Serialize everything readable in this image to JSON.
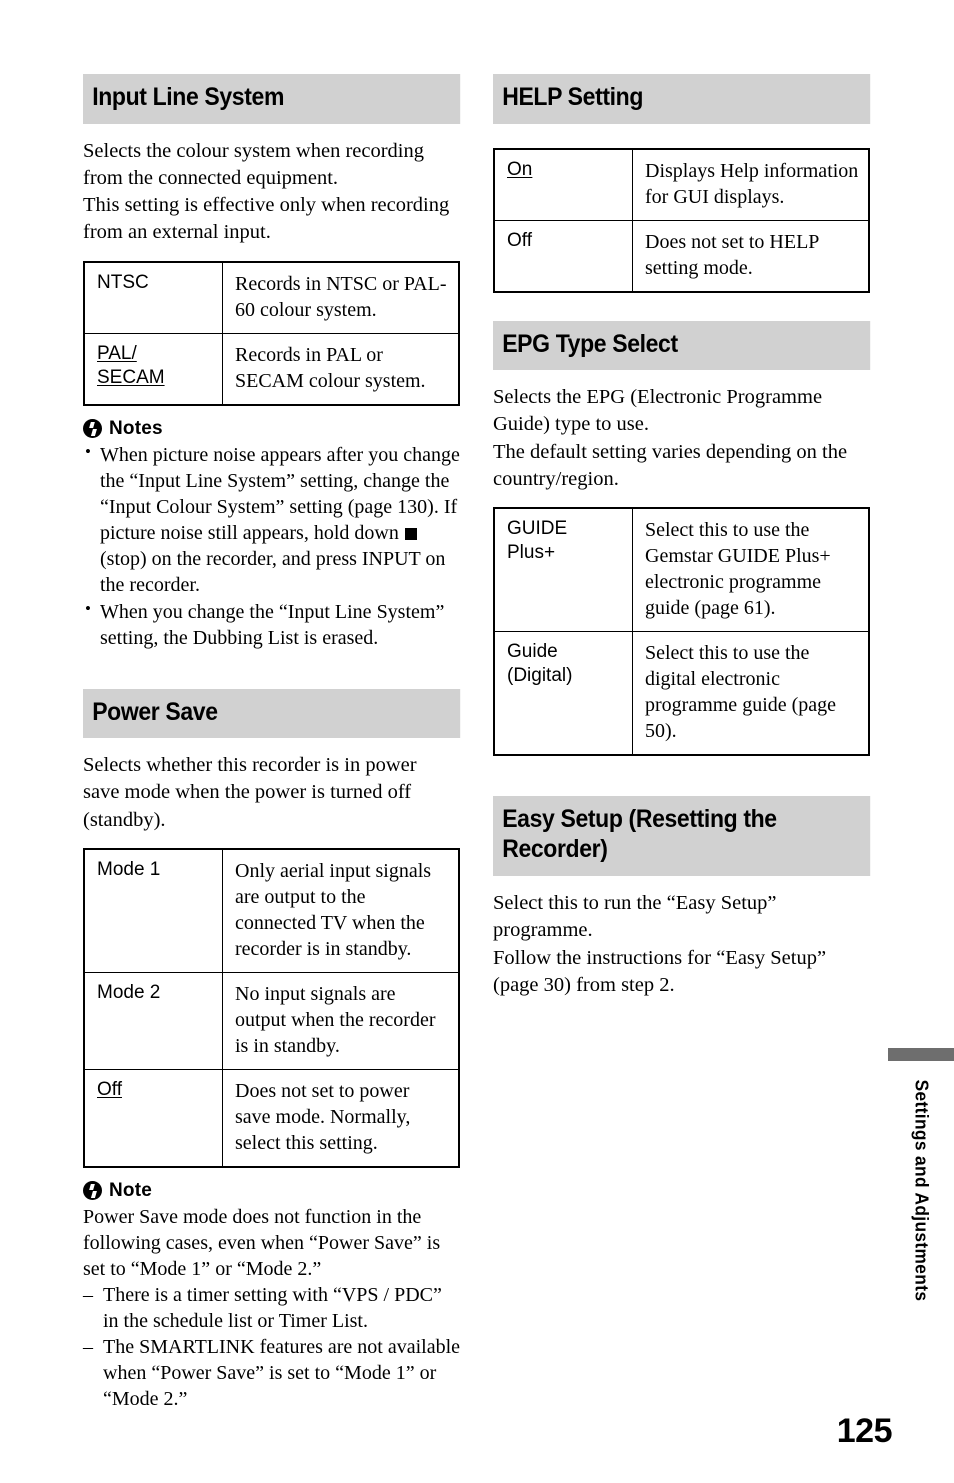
{
  "page": {
    "number": "125",
    "side_tab_label": "Settings and Adjustments"
  },
  "left_column": {
    "input_line_system": {
      "heading": "Input Line System",
      "intro_line_1": "Selects the colour system when recording",
      "intro_line_2": "from the connected equipment.",
      "intro_line_3": "This setting is effective only when recording",
      "intro_line_4": "from an external input.",
      "table": [
        {
          "term": "NTSC",
          "term_underlined": false,
          "description": "Records in NTSC or PAL-60 colour system."
        },
        {
          "term_line_1": "PAL/",
          "term_line_2": "SECAM",
          "term_underlined": true,
          "description": "Records in PAL or SECAM colour system."
        }
      ],
      "notes_title": "Notes",
      "notes_icon": "note-lightning-icon",
      "notes": [
        {
          "text_before_symbol": "When picture noise appears after you change the “Input Line System” setting, change the “Input Colour System” setting (page 130). If picture noise still appears, hold down ",
          "symbol": "stop-square-icon",
          "text_after_symbol": " (stop) on the recorder, and press INPUT on the recorder."
        },
        {
          "text_before_symbol": "When you change the “Input Line System” setting, the Dubbing List is erased.",
          "symbol": null,
          "text_after_symbol": ""
        }
      ]
    },
    "power_save": {
      "heading": "Power Save",
      "intro_line_1": "Selects whether this recorder is in power",
      "intro_line_2": "save mode when the power is turned off",
      "intro_line_3": "(standby).",
      "table": [
        {
          "term": "Mode 1",
          "term_underlined": false,
          "description": "Only aerial input signals are output to the connected TV when the recorder is in standby."
        },
        {
          "term": "Mode 2",
          "term_underlined": false,
          "description": "No input signals are output when the recorder is in standby."
        },
        {
          "term": "Off",
          "term_underlined": true,
          "description": "Does not set to power save mode. Normally, select this setting."
        }
      ],
      "note_title": "Note",
      "note_icon": "note-lightning-icon",
      "note_paragraph": "Power Save mode does not function in the following cases, even when “Power Save” is set to “Mode 1” or “Mode 2.”",
      "note_items": [
        "There is a timer setting with “VPS / PDC” in the schedule list or Timer List.",
        "The SMARTLINK features are not available when “Power Save” is set to “Mode 1” or “Mode 2.”"
      ]
    }
  },
  "right_column": {
    "help_setting": {
      "heading": "HELP Setting",
      "table": [
        {
          "term": "On",
          "term_underlined": true,
          "description": "Displays Help information for GUI displays."
        },
        {
          "term": "Off",
          "term_underlined": false,
          "description": "Does not set to HELP setting mode."
        }
      ]
    },
    "epg_type_select": {
      "heading": "EPG Type Select",
      "intro_line_1": "Selects the EPG (Electronic Programme",
      "intro_line_2": "Guide) type to use.",
      "intro_line_3": "The default setting varies depending on the",
      "intro_line_4": "country/region.",
      "table": [
        {
          "term_line_1": "GUIDE",
          "term_line_2": "Plus+",
          "term_underlined": false,
          "description": "Select this to use the Gemstar GUIDE Plus+ electronic programme guide (page 61)."
        },
        {
          "term_line_1": "Guide",
          "term_line_2": "(Digital)",
          "term_underlined": false,
          "description": "Select this to use the digital electronic programme guide (page 50)."
        }
      ]
    },
    "easy_setup": {
      "heading_line_1": "Easy Setup (Resetting the",
      "heading_line_2": "Recorder)",
      "body_line_1": "Select this to run the “Easy Setup”",
      "body_line_2": "programme.",
      "body_line_3": "Follow the instructions for “Easy Setup”",
      "body_line_4": "(page 30) from step 2."
    }
  },
  "colors": {
    "heading_band": "#d1d1d1",
    "side_tab_bar": "#6e6e6e",
    "text": "#000000",
    "background": "#ffffff"
  }
}
